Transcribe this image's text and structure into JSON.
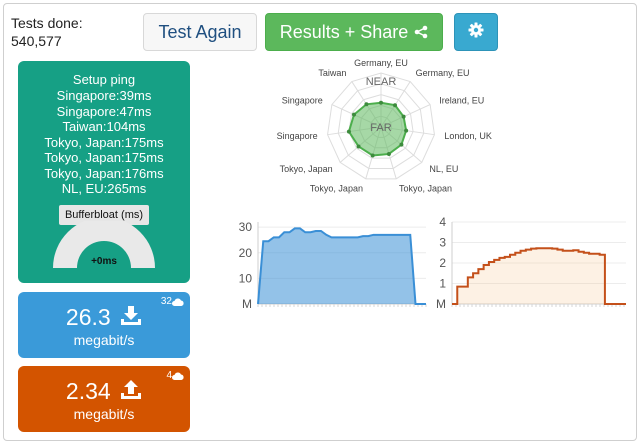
{
  "header": {
    "tests_label": "Tests done:",
    "tests_count": "540,577",
    "test_again": "Test Again",
    "results_share": "Results + Share"
  },
  "ping": {
    "title": "Setup ping",
    "rows": [
      "Singapore:39ms",
      "Singapore:47ms",
      "Taiwan:104ms",
      "Tokyo, Japan:175ms",
      "Tokyo, Japan:175ms",
      "Tokyo, Japan:176ms",
      "NL, EU:265ms"
    ],
    "bufferbloat_label": "Bufferbloat (ms)",
    "bufferbloat_value": "+0ms"
  },
  "download": {
    "speed": "26.3",
    "unit": "megabit/s",
    "connections": "32"
  },
  "upload": {
    "speed": "2.34",
    "unit": "megabit/s",
    "connections": "4"
  },
  "radar": {
    "near_label": "NEAR",
    "far_label": "FAR",
    "spokes": [
      "Germany, EU",
      "Germany, EU",
      "Ireland, EU",
      "London, UK",
      "NL, EU",
      "Tokyo, Japan",
      "Tokyo, Japan",
      "Tokyo, Japan",
      "Singapore",
      "Singapore",
      "Taiwan"
    ]
  },
  "colors": {
    "ping_panel": "#16a085",
    "download": "#3a9ad9",
    "upload": "#d35400",
    "share_button": "#5cb85c",
    "settings_button": "#39a9d0"
  },
  "chart_data": [
    {
      "type": "area",
      "title": "",
      "series": [
        {
          "values": [
            0,
            24.5,
            24.5,
            26,
            26,
            28,
            28,
            29.5,
            29.5,
            28,
            28,
            28.5,
            28.5,
            27,
            26,
            26,
            26,
            26,
            26,
            26,
            26.5,
            26.5,
            27,
            27,
            27,
            27,
            27,
            27,
            27,
            27,
            0,
            0,
            0
          ]
        }
      ],
      "yticks": [
        "M",
        "10",
        "20",
        "30"
      ],
      "ylim": [
        0,
        32
      ]
    },
    {
      "type": "area",
      "title": "",
      "series": [
        {
          "values": [
            0,
            0.85,
            0.85,
            1.3,
            1.5,
            1.7,
            1.9,
            2.05,
            2.15,
            2.25,
            2.3,
            2.4,
            2.5,
            2.6,
            2.65,
            2.7,
            2.72,
            2.72,
            2.72,
            2.7,
            2.65,
            2.6,
            2.6,
            2.62,
            2.55,
            2.5,
            2.45,
            2.45,
            2.4,
            0,
            0,
            0,
            0,
            0
          ]
        }
      ],
      "yticks": [
        "M",
        "1",
        "2",
        "3",
        "4"
      ],
      "ylim": [
        0,
        4
      ]
    }
  ]
}
